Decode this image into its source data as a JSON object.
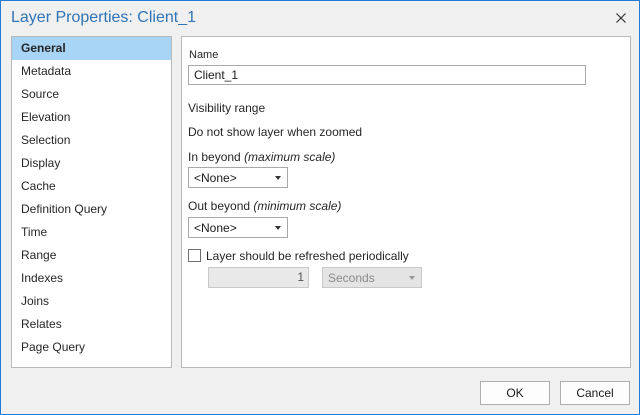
{
  "window": {
    "title": "Layer Properties: Client_1",
    "close_icon": "close-icon"
  },
  "sidebar": {
    "items": [
      {
        "label": "General",
        "selected": true
      },
      {
        "label": "Metadata"
      },
      {
        "label": "Source"
      },
      {
        "label": "Elevation"
      },
      {
        "label": "Selection"
      },
      {
        "label": "Display"
      },
      {
        "label": "Cache"
      },
      {
        "label": "Definition Query"
      },
      {
        "label": "Time"
      },
      {
        "label": "Range"
      },
      {
        "label": "Indexes"
      },
      {
        "label": "Joins"
      },
      {
        "label": "Relates"
      },
      {
        "label": "Page Query"
      }
    ]
  },
  "general": {
    "name_label": "Name",
    "name_value": "Client_1",
    "visibility_heading": "Visibility range",
    "visibility_hint": "Do not show layer when zoomed",
    "in_beyond_label": "In beyond",
    "in_beyond_note": "(maximum scale)",
    "in_beyond_value": "<None>",
    "out_beyond_label": "Out beyond",
    "out_beyond_note": "(minimum scale)",
    "out_beyond_value": "<None>",
    "refresh_label": "Layer should be refreshed periodically",
    "refresh_checked": false,
    "refresh_interval": "1",
    "refresh_unit": "Seconds"
  },
  "buttons": {
    "ok": "OK",
    "cancel": "Cancel"
  },
  "colors": {
    "accent": "#2f74b5",
    "border": "#1e7bd6",
    "selected_bg": "#a8d4f5"
  }
}
